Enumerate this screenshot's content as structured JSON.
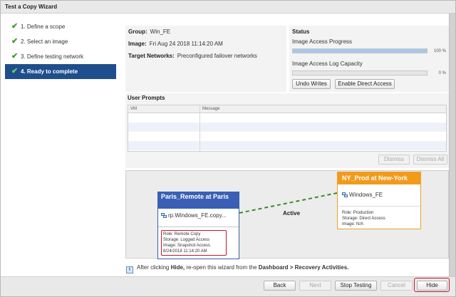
{
  "window": {
    "title": "Test a Copy Wizard"
  },
  "steps": [
    {
      "label": "1. Define a scope"
    },
    {
      "label": "2. Select an image"
    },
    {
      "label": "3. Define testing network"
    },
    {
      "label": "4. Ready to complete"
    }
  ],
  "info": {
    "group_label": "Group:",
    "group_value": "Win_FE",
    "image_label": "Image:",
    "image_value": "Fri Aug 24 2018 11:14:20 AM",
    "networks_label": "Target Networks:",
    "networks_value": "Preconfigured failover networks"
  },
  "status": {
    "title": "Status",
    "progress_label": "Image Access Progress",
    "progress_value": "100 %",
    "progress_fraction": 1.0,
    "log_label": "Image Access Log Capacity",
    "log_value": "0 %",
    "log_fraction": 0.0,
    "undo_label": "Undo Writes",
    "direct_label": "Enable Direct Access"
  },
  "prompts": {
    "title": "User Prompts",
    "columns": [
      "VM",
      "Message"
    ],
    "dismiss_label": "Dismiss",
    "dismiss_all_label": "Dismiss All"
  },
  "diagram": {
    "left_title": "Paris_Remote at Paris",
    "left_vm": "rp.Windows_FE.copy...",
    "left_role": "Role: Remote Copy",
    "left_storage": "Storage: Logged Access",
    "left_image": "Image: Snapshot Access",
    "left_time": "8/24/2018 11:14:20 AM",
    "link_label": "Active",
    "right_title": "NY_Prod at New-York",
    "right_vm": "Windows_FE",
    "right_role": "Role: Production",
    "right_storage": "Storage: Direct Access",
    "right_image": "Image: N/A"
  },
  "note": {
    "prefix": "After clicking ",
    "hide_word": "Hide,",
    "middle": " re-open this wizard from the ",
    "path": "Dashboard > Recovery Activities."
  },
  "footer": {
    "back": "Back",
    "next": "Next",
    "stop": "Stop Testing",
    "cancel": "Cancel",
    "hide": "Hide"
  },
  "colors": {
    "selected_step": "#1f4e8c",
    "check": "#3e9a2a",
    "remote_header": "#3a5fb5",
    "prod_header": "#f29a1c",
    "link": "#3a8a2a",
    "highlight": "#c8142a"
  },
  "icons": [
    "checkmark-icon",
    "vm-icon",
    "info-icon"
  ]
}
